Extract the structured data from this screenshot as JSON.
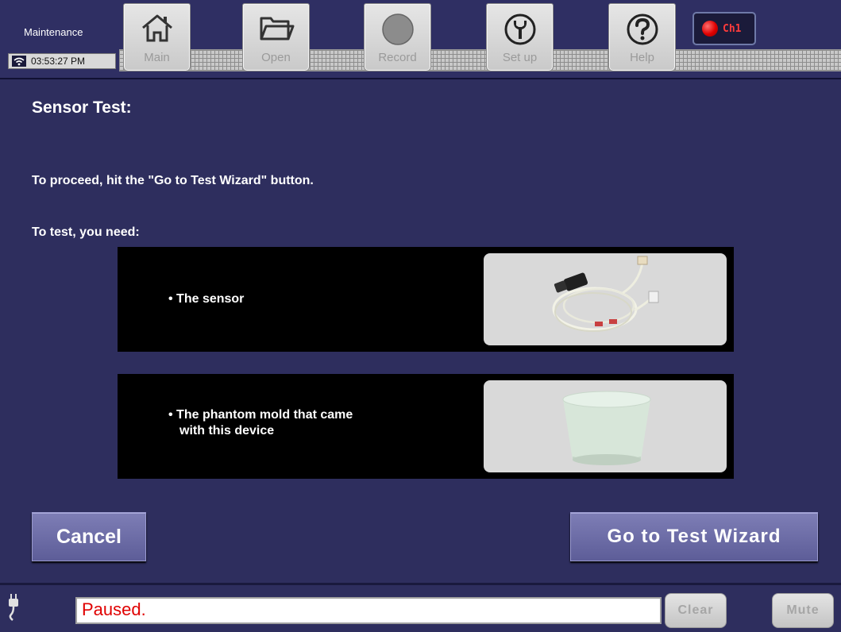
{
  "topbar": {
    "mode_label": "Maintenance",
    "clock": "03:53:27 PM",
    "nav": [
      {
        "label": "Main",
        "icon": "home-icon"
      },
      {
        "label": "Open",
        "icon": "folder-icon"
      },
      {
        "label": "Record",
        "icon": "record-icon"
      },
      {
        "label": "Set up",
        "icon": "wrench-icon"
      },
      {
        "label": "Help",
        "icon": "help-icon"
      }
    ],
    "channel": {
      "label": "Ch1",
      "color": "#e00000"
    }
  },
  "main": {
    "title": "Sensor Test:",
    "instruction": "To proceed, hit the \"Go to Test Wizard\" button.",
    "need_label": "To test, you need:",
    "requirements": [
      {
        "text_line1": "• The sensor",
        "text_line2": ""
      },
      {
        "text_line1": "• The phantom mold that came",
        "text_line2": "with this device"
      }
    ],
    "cancel_label": "Cancel",
    "wizard_label": "Go to Test Wizard"
  },
  "bottombar": {
    "status": "Paused.",
    "clear_label": "Clear",
    "mute_label": "Mute"
  },
  "colors": {
    "background": "#2e2e5e",
    "button": "#6b6ba6",
    "status_text": "#e00000"
  }
}
